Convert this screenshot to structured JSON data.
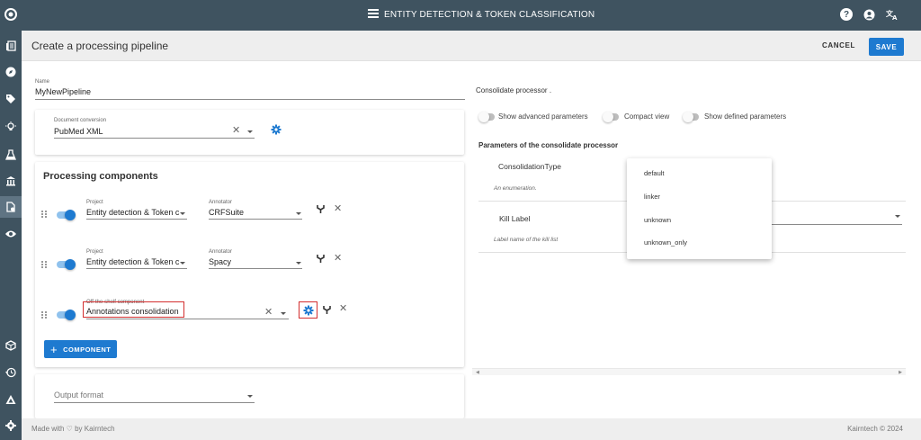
{
  "app": {
    "title": "ENTITY DETECTION & TOKEN CLASSIFICATION"
  },
  "rail": {
    "items": [
      "logo-icon",
      "documents-icon",
      "explore-icon",
      "tags-icon",
      "bulb-icon",
      "flask-icon",
      "library-icon",
      "pipeline-icon",
      "eye-icon",
      "cube-icon",
      "history-icon",
      "triangle-icon",
      "settings-icon"
    ],
    "active": "pipeline-icon"
  },
  "header": {
    "title": "Create a processing pipeline",
    "cancel_label": "CANCEL",
    "save_label": "SAVE"
  },
  "form": {
    "name_label": "Name",
    "name_value": "MyNewPipeline",
    "document_conversion": {
      "label": "Document conversion",
      "value": "PubMed XML"
    },
    "processing_components": {
      "title": "Processing components",
      "items": [
        {
          "project_label": "Project",
          "project_value": "Entity detection & Token c",
          "annotator_label": "Annotator",
          "annotator_value": "CRFSuite",
          "enabled": true
        },
        {
          "project_label": "Project",
          "project_value": "Entity detection & Token c",
          "annotator_label": "Annotator",
          "annotator_value": "Spacy",
          "enabled": true
        },
        {
          "component_label": "Off-the-shelf component",
          "component_value": "Annotations consolidation",
          "enabled": true
        }
      ],
      "add_label": "COMPONENT"
    },
    "output_format": {
      "placeholder": "Output format"
    }
  },
  "right_panel": {
    "title": "Consolidate processor .",
    "toggles": [
      {
        "label": "Show advanced parameters",
        "on": false
      },
      {
        "label": "Compact view",
        "on": false
      },
      {
        "label": "Show defined parameters",
        "on": false
      }
    ],
    "params_title": "Parameters of the consolidate processor",
    "params": [
      {
        "name": "ConsolidationType",
        "description": "An enumeration."
      },
      {
        "name": "Kill Label",
        "description": "Label name of the kill list"
      }
    ],
    "dropdown_options": [
      "default",
      "linker",
      "unknown",
      "unknown_only"
    ]
  },
  "footer": {
    "left": "Made with ♡ by Kairntech",
    "right": "Kairntech © 2024"
  },
  "colors": {
    "primary": "#1e7ad0",
    "nav": "#3f5360",
    "highlight": "#d32f2f"
  }
}
